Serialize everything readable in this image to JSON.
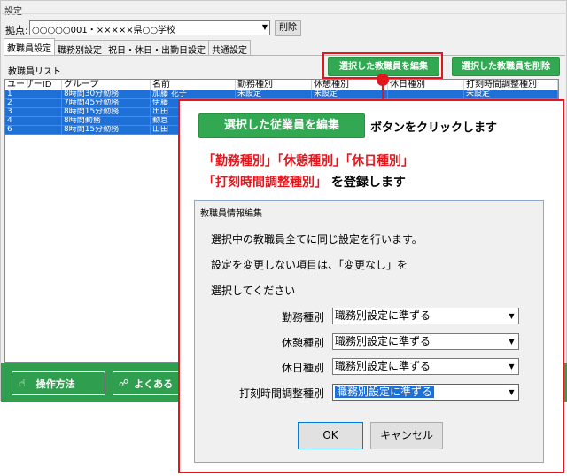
{
  "window": {
    "title": "設定",
    "base_label": "拠点:",
    "base_value": "○○○○○001・×××××県○○学校",
    "delete_button": "削除",
    "tabs": [
      "教職員設定",
      "職務別設定",
      "祝日・休日・出勤日設定",
      "共通設定"
    ],
    "active_tab": 0,
    "list_label": "教職員リスト",
    "edit_selected_button": "選択した教職員を編集",
    "delete_selected_button": "選択した教職員を削除",
    "columns": [
      "ユーザーID",
      "グループ",
      "名前",
      "勤務種別",
      "休憩種別",
      "休日種別",
      "打刻時間調整種別"
    ],
    "rows": [
      [
        "1",
        "8時間30分勤務",
        "加藤 花子",
        "未設定",
        "未設定",
        "",
        "未設定"
      ],
      [
        "2",
        "7時間45分勤務",
        "伊藤",
        "",
        "",
        "",
        ""
      ],
      [
        "3",
        "8時間15分勤務",
        "出田",
        "",
        "",
        "",
        ""
      ],
      [
        "4",
        "8時間勤務",
        "勤怠",
        "",
        "",
        "",
        ""
      ],
      [
        "6",
        "8時間15分勤務",
        "山田",
        "",
        "",
        "",
        ""
      ]
    ],
    "howto_button": "操作方法",
    "faq_button": "よくある"
  },
  "callout": {
    "button_label": "選択した従業員を編集",
    "text1": "ボタンをクリックします",
    "red_line1": "「勤務種別」「休憩種別」「休日種別」",
    "red_line2": "「打刻時間調整種別」",
    "line2_suffix": "を登録します"
  },
  "dialog": {
    "title": "教職員情報編集",
    "line1": "選択中の教職員全てに同じ設定を行います。",
    "line2": "設定を変更しない項目は、「変更なし」を",
    "line3": "選択してください",
    "fields": [
      {
        "label": "勤務種別",
        "value": "職務別設定に準ずる"
      },
      {
        "label": "休憩種別",
        "value": "職務別設定に準ずる"
      },
      {
        "label": "休日種別",
        "value": "職務別設定に準ずる"
      },
      {
        "label": "打刻時間調整種別",
        "value": "職務別設定に準ずる"
      }
    ],
    "ok_button": "OK",
    "cancel_button": "キャンセル"
  },
  "colors": {
    "accent_green": "#32a852",
    "highlight_red": "#e2161d",
    "selection_blue": "#1e70d6"
  }
}
